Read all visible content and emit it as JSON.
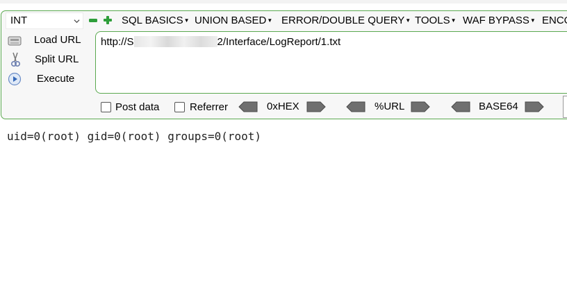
{
  "toolbar": {
    "select_value": "INT",
    "menus": [
      {
        "label": "SQL BASICS"
      },
      {
        "label": "UNION BASED"
      },
      {
        "label": "ERROR/DOUBLE QUERY"
      },
      {
        "label": "TOOLS"
      },
      {
        "label": "WAF BYPASS"
      },
      {
        "label": "ENCO"
      }
    ]
  },
  "side": {
    "load_url": "Load URL",
    "split_url": "Split URL",
    "execute": "Execute"
  },
  "url": {
    "prefix": "http://",
    "visible_start": "S",
    "suffix": "2/Interface/LogReport/1.txt"
  },
  "options": {
    "post_data": "Post data",
    "referrer": "Referrer",
    "post_data_checked": false,
    "referrer_checked": false
  },
  "encoders": {
    "hex": "0xHEX",
    "url": "%URL",
    "base64": "BASE64"
  },
  "output": {
    "text": "uid=0(root) gid=0(root) groups=0(root)"
  },
  "colors": {
    "accent_green": "#5aa84f",
    "minus_green": "#2e9e3a",
    "plus_green": "#2e9e3a"
  }
}
